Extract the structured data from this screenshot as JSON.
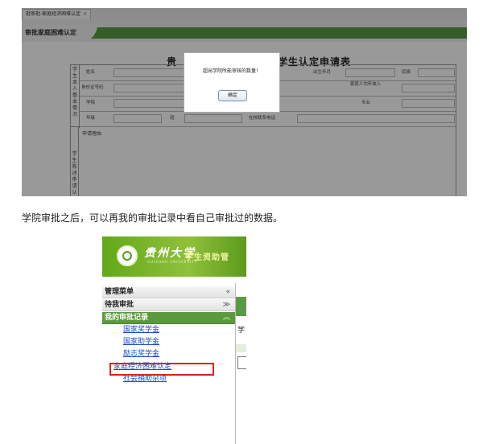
{
  "screenshot1": {
    "tab_label": "批审批-家庭经济困难认定",
    "tab_close": "×",
    "page_title": "审批家庭困难认定",
    "form_title_left": "贵",
    "form_title_right": "学生认定申请表",
    "section_labels": {
      "basic": "学生本人基本情况",
      "reason": "学生陈述申请认定理由"
    },
    "fields": {
      "name": "姓名",
      "birth": "出生年月",
      "ethnicity": "民族",
      "id_number": "身份证号码",
      "household_income": "家庭人均年收入",
      "college": "学院",
      "major": "专业",
      "grade": "年级",
      "class": "班",
      "contact": "在校联系电话"
    },
    "reason_label": "申请理由",
    "dialog": {
      "message": "超出学院所能审核的数量！",
      "ok_label": "确定"
    }
  },
  "caption": "学院审批之后，可以再我的审批记录中看自己审批过的数据。",
  "screenshot2": {
    "logo_text": "贵州大学",
    "logo_sub": "GUIZHOU UNIVERSITY",
    "system_title": "学生资助管",
    "menu": {
      "header": {
        "label": "管理菜单",
        "icon": "«"
      },
      "pending": {
        "label": "待我审批",
        "icon": "≫"
      },
      "my_records": {
        "label": "我的审批记录",
        "icon": "︽"
      },
      "items": [
        "国家奖学金",
        "国家助学金",
        "励志奖学金",
        "家庭经济困难认定",
        "社会捐助杂项"
      ]
    },
    "right_pane_char": "学",
    "highlight_color": "#e02020",
    "accent_color": "#5b9a3c"
  }
}
